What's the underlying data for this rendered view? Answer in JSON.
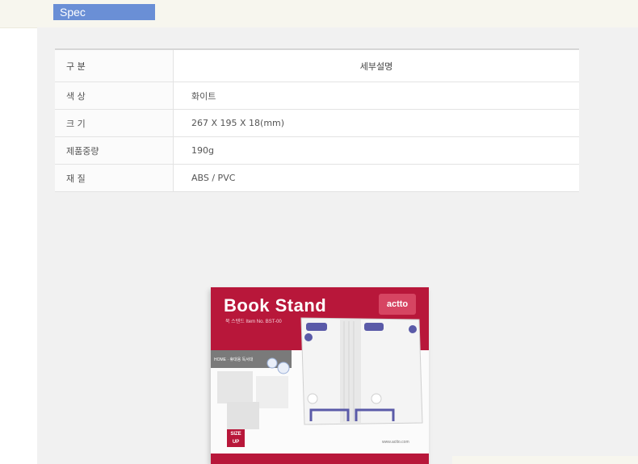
{
  "section_tab": {
    "label": "Spec"
  },
  "spec_table": {
    "header": {
      "key": "구 분",
      "value": "세부설명"
    },
    "rows": [
      {
        "key": "색 상",
        "value": "화이트"
      },
      {
        "key": "크 기",
        "value": "267 X 195 X 18(mm)"
      },
      {
        "key": "제품중량",
        "value": "190g"
      },
      {
        "key": "재 질",
        "value": "ABS / PVC"
      }
    ]
  },
  "product_box": {
    "title": "Book Stand",
    "subtitle": "북 스탠드  Item No. BST-00",
    "brand": "actto",
    "tagline": "HOME · 휴대용 독서대",
    "size_badge": "SIZE UP",
    "url": "www.actto.com",
    "colors": {
      "band": "#b8173a",
      "accent": "#5a5aa8"
    }
  }
}
